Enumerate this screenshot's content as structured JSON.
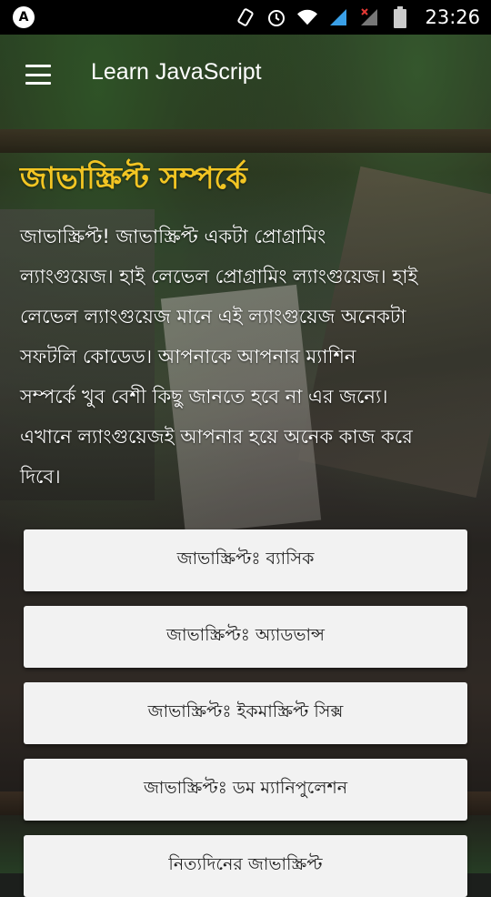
{
  "status_bar": {
    "time": "23:26",
    "left_icon": "notification-a-icon",
    "icons": [
      "rotate-icon",
      "alarm-icon",
      "wifi-icon",
      "signal-icon",
      "signal-x-icon",
      "battery-icon"
    ]
  },
  "app_bar": {
    "title": "Learn JavaScript",
    "menu_icon": "hamburger-menu-icon"
  },
  "main": {
    "heading": "জাভাস্ক্রিপ্ট সম্পর্কে",
    "body_lines": [
      "জাভাস্ক্রিপ্ট! জাভাস্ক্রিপ্ট একটা প্রোগ্রামিং",
      "ল্যাংগুয়েজ। হাই লেভেল প্রোগ্রামিং ল্যাংগুয়েজ। হাই",
      "লেভেল ল্যাংগুয়েজ মানে এই ল্যাংগুয়েজ অনেকটা",
      "সফটলি কোডেড। আপনাকে আপনার ম্যাশিন",
      "সম্পর্কে খুব বেশী কিছু জানতে হবে না এর জন্যে।",
      "এখানে ল্যাংগুয়েজই আপনার হয়ে অনেক কাজ করে",
      "দিবে।"
    ],
    "buttons": [
      "জাভাস্ক্রিপ্টঃ ব্যাসিক",
      "জাভাস্ক্রিপ্টঃ অ্যাডভান্স",
      "জাভাস্ক্রিপ্টঃ ইকমাস্ক্রিপ্ট সিক্স",
      "জাভাস্ক্রিপ্টঃ ডম ম্যানিপুলেশন",
      "নিত্যদিনের জাভাস্ক্রিপ্ট"
    ]
  },
  "colors": {
    "heading": "#f2c523",
    "button_bg": "#f2f2f2",
    "status_bar": "#000000"
  }
}
